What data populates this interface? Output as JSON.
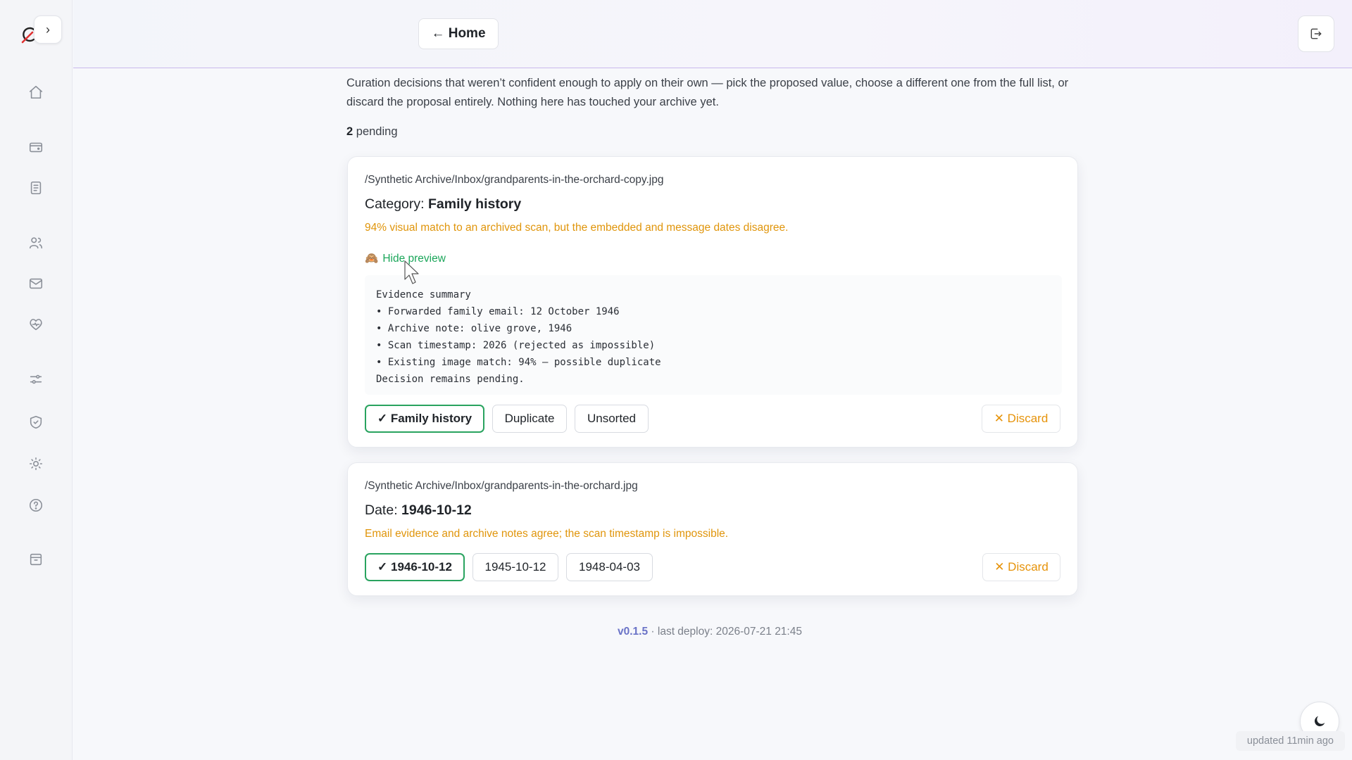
{
  "sidebar": {
    "expand_label": "›",
    "icons": [
      "home-icon",
      "wallet-icon",
      "document-icon",
      "people-icon",
      "mail-icon",
      "heart-pulse-icon",
      "sliders-icon",
      "shield-check-icon",
      "sun-icon",
      "help-icon",
      "archive-icon"
    ]
  },
  "header": {
    "home_label": "← Home",
    "logout_icon": "logout-icon"
  },
  "intro": "Curation decisions that weren’t confident enough to apply on their own — pick the proposed value, choose a different one from the full list, or discard the proposal entirely. Nothing here has touched your archive yet.",
  "pending": {
    "count": "2",
    "label": " pending"
  },
  "cards": [
    {
      "path": "/Synthetic Archive/Inbox/grandparents-in-the-orchard-copy.jpg",
      "field": "Category: ",
      "value": "Family history",
      "reason": "94% visual match to an archived scan, but the embedded and message dates disagree.",
      "preview_toggle": "Hide preview",
      "preview_icon": "🙈",
      "preview_text": "Evidence summary\n• Forwarded family email: 12 October 1946\n• Archive note: olive grove, 1946\n• Scan timestamp: 2026 (rejected as impossible)\n• Existing image match: 94% — possible duplicate\nDecision remains pending.",
      "options": [
        "✓ Family history",
        "Duplicate",
        "Unsorted"
      ],
      "discard": "✕ Discard"
    },
    {
      "path": "/Synthetic Archive/Inbox/grandparents-in-the-orchard.jpg",
      "field": "Date: ",
      "value": "1946-10-12",
      "reason": "Email evidence and archive notes agree; the scan timestamp is impossible.",
      "options": [
        "✓ 1946-10-12",
        "1945-10-12",
        "1948-04-03"
      ],
      "discard": "✕ Discard"
    }
  ],
  "footer": {
    "version": "v0.1.5",
    "deploy": " · last deploy: 2026-07-21 21:45"
  },
  "status": {
    "updated": "updated 11min ago"
  },
  "colors": {
    "accent_green": "#29a35f",
    "warning": "#e0950b",
    "version": "#6a73c7"
  }
}
